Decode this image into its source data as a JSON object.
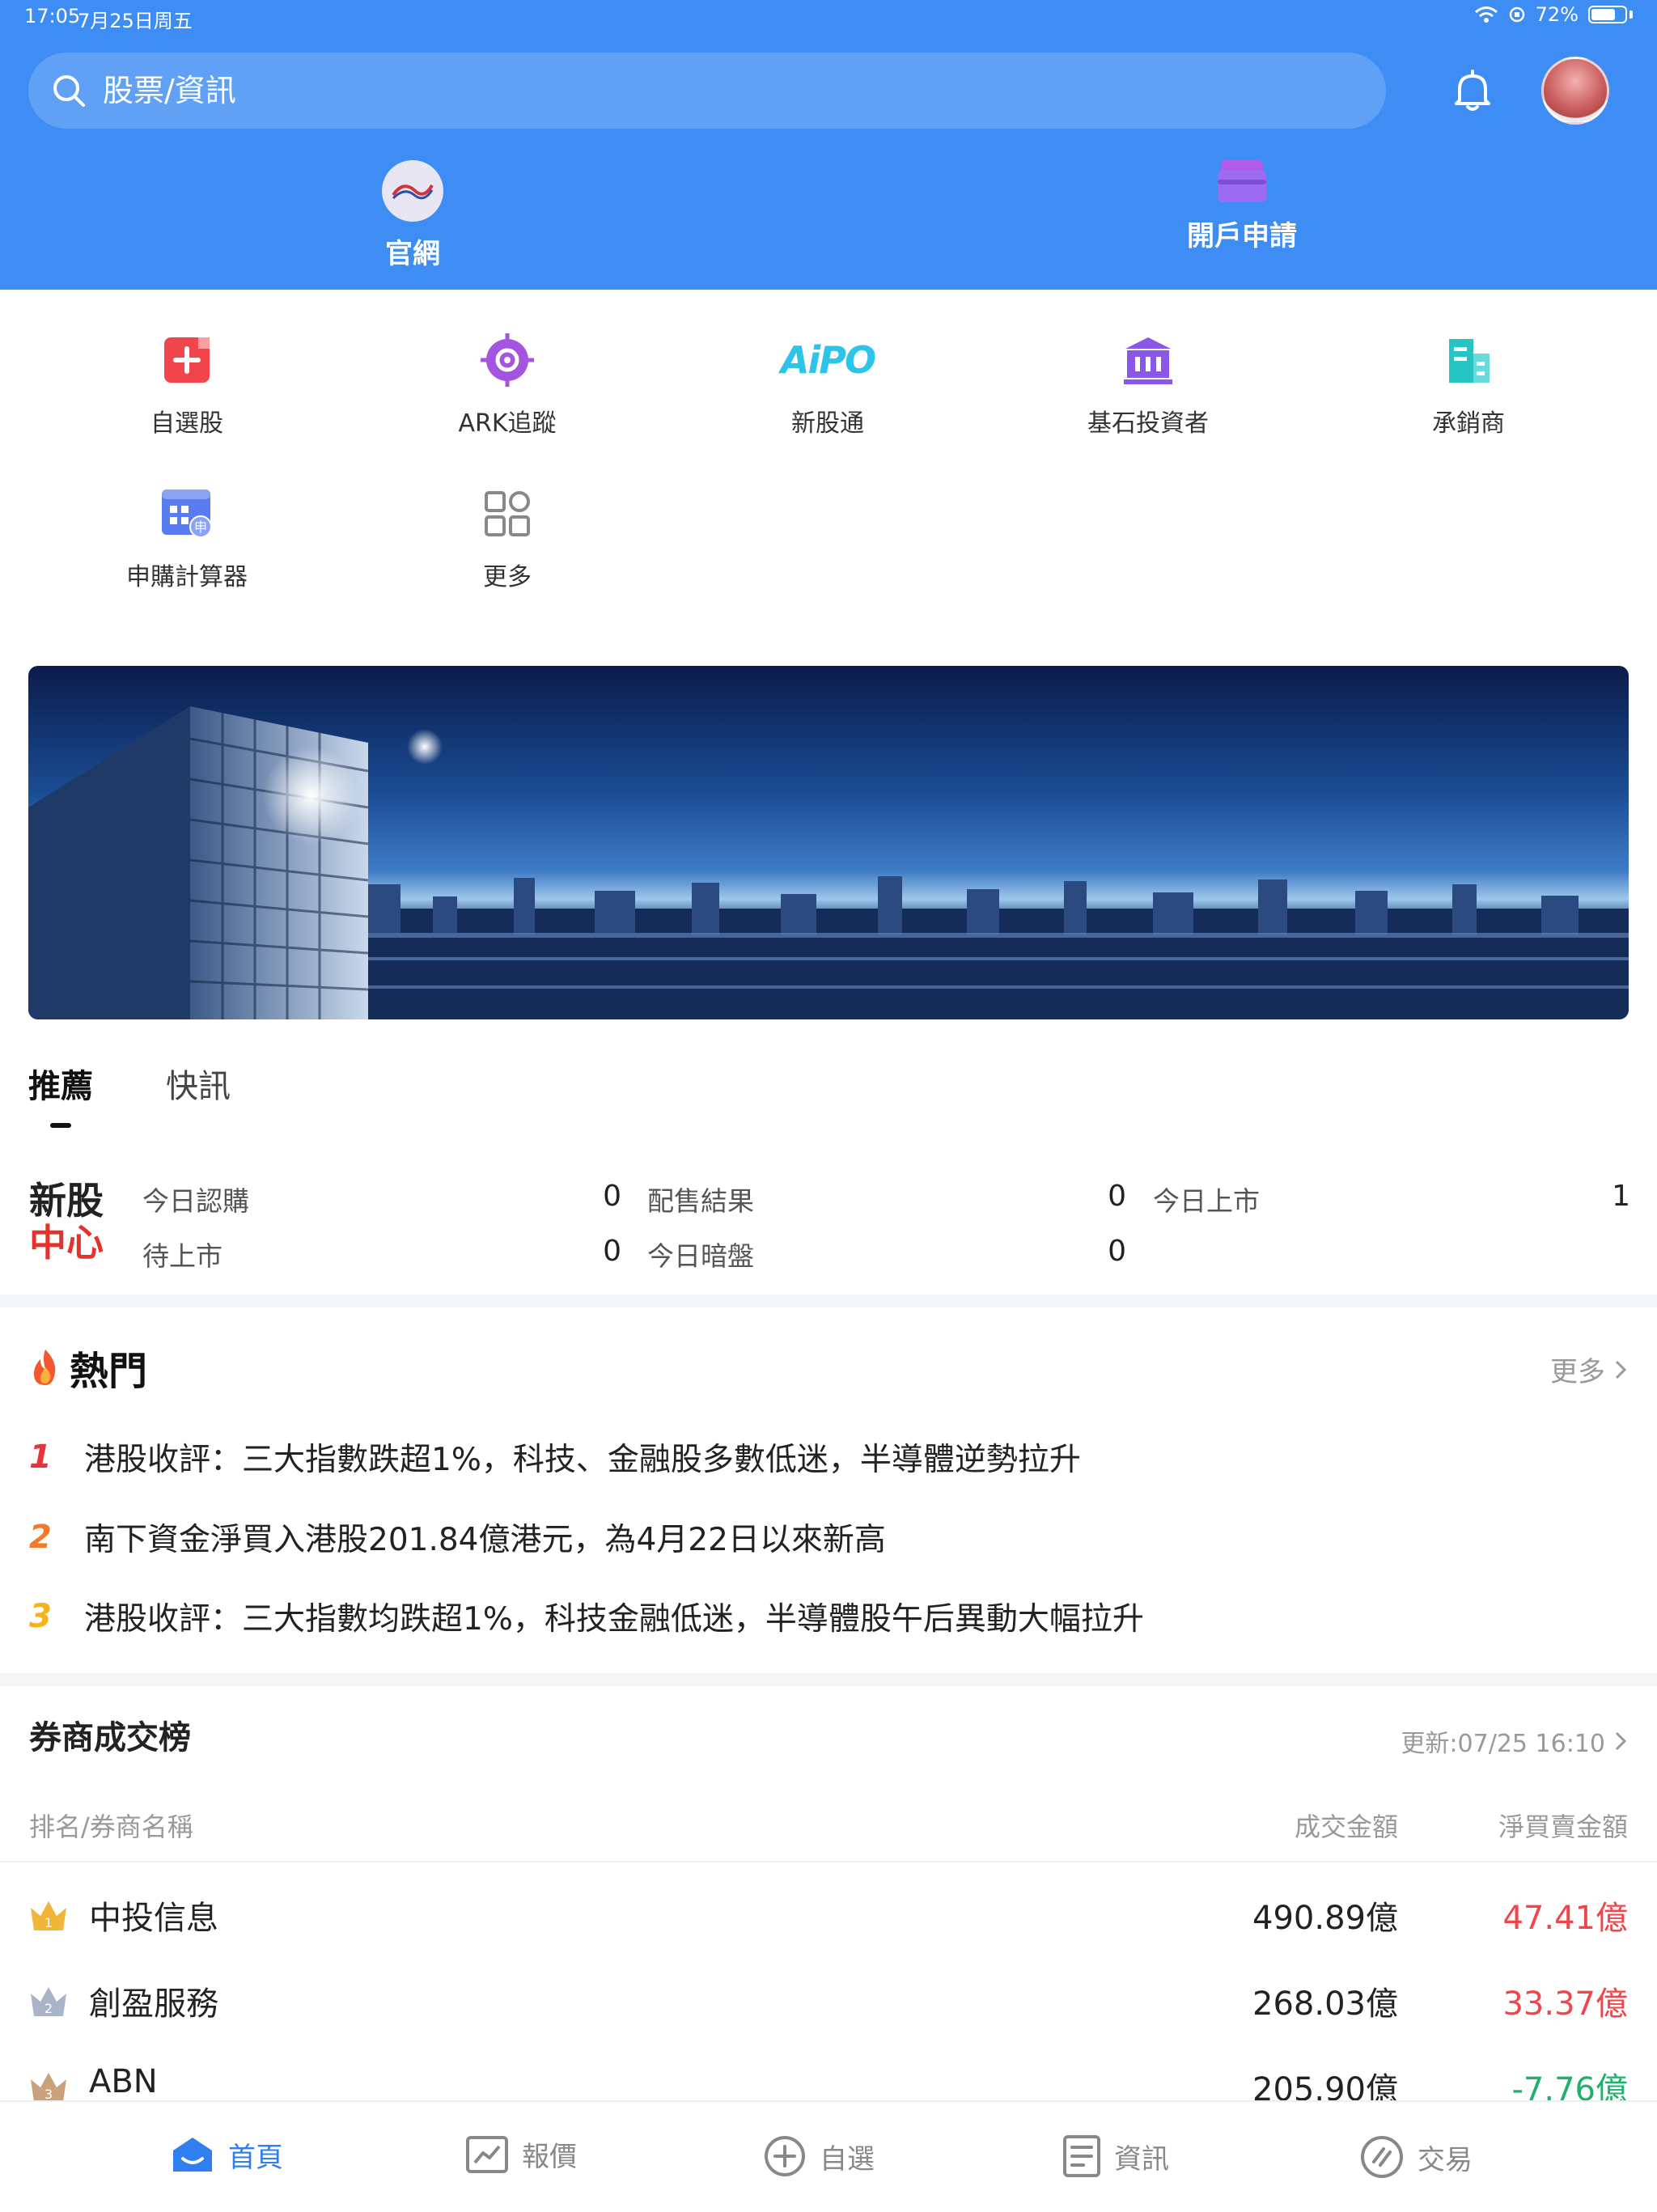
{
  "status": {
    "time": "17:05",
    "date": "7月25日周五",
    "battery": "72%",
    "battery_level": 0.72
  },
  "search": {
    "placeholder": "股票/資訊"
  },
  "header_links": {
    "official": "官網",
    "open_account": "開戶申請"
  },
  "quick_menu": [
    {
      "label": "自選股",
      "icon": "plus-square-icon",
      "color": "#f0454a"
    },
    {
      "label": "ARK追蹤",
      "icon": "target-icon",
      "color": "#a455e0"
    },
    {
      "label": "新股通",
      "icon": "aipo-icon",
      "color": "#2ec3e8",
      "icon_text": "AiPO"
    },
    {
      "label": "基石投資者",
      "icon": "bank-icon",
      "color": "#8a57e6"
    },
    {
      "label": "承銷商",
      "icon": "building-icon",
      "color": "#27c4c4"
    },
    {
      "label": "申購計算器",
      "icon": "calculator-icon",
      "color": "#5a7cf0",
      "badge": "申"
    },
    {
      "label": "更多",
      "icon": "grid-icon",
      "color": "#888888"
    }
  ],
  "tabs": {
    "recommend": "推薦",
    "flash": "快訊"
  },
  "ipo_center": {
    "logo_line1": "新股",
    "logo_line2": "中心",
    "items": [
      {
        "label": "今日認購",
        "value": "0"
      },
      {
        "label": "配售結果",
        "value": "0"
      },
      {
        "label": "今日上市",
        "value": "1"
      },
      {
        "label": "待上市",
        "value": "0"
      },
      {
        "label": "今日暗盤",
        "value": "0"
      }
    ]
  },
  "hot": {
    "title": "熱門",
    "more": "更多",
    "items": [
      {
        "rank": "1",
        "color": "#e8333a",
        "text": "港股收評：三大指數跌超1%，科技、金融股多數低迷，半導體逆勢拉升"
      },
      {
        "rank": "2",
        "color": "#f07a2a",
        "text": "南下資金淨買入港股201.84億港元，為4月22日以來新高"
      },
      {
        "rank": "3",
        "color": "#f5b21c",
        "text": "港股收評：三大指數均跌超1%，科技金融低迷，半導體股午后異動大幅拉升"
      }
    ]
  },
  "broker_rank": {
    "title": "券商成交榜",
    "updated": "更新:07/25 16:10",
    "col_name": "排名/券商名稱",
    "col_amount": "成交金額",
    "col_net": "淨買賣金額",
    "rows": [
      {
        "rank": "1",
        "name": "中投信息",
        "amount": "490.89億",
        "net": "47.41億",
        "net_color": "#f0454a",
        "crown_color": "#f2b53a"
      },
      {
        "rank": "2",
        "name": "創盈服務",
        "amount": "268.03億",
        "net": "33.37億",
        "net_color": "#f0454a",
        "crown_color": "#a9b4c6"
      },
      {
        "rank": "3",
        "name": "ABN",
        "amount": "205.90億",
        "net": "-7.76億",
        "net_color": "#1fb06b",
        "crown_color": "#c9a27c"
      }
    ]
  },
  "bottom_nav": [
    {
      "label": "首頁",
      "icon": "home-icon",
      "active": true
    },
    {
      "label": "報價",
      "icon": "chart-icon",
      "active": false
    },
    {
      "label": "自選",
      "icon": "add-circle-icon",
      "active": false
    },
    {
      "label": "資訊",
      "icon": "news-icon",
      "active": false
    },
    {
      "label": "交易",
      "icon": "trade-icon",
      "active": false
    }
  ],
  "colors": {
    "primary": "#3d8df5",
    "up": "#f0454a",
    "down": "#1fb06b"
  }
}
